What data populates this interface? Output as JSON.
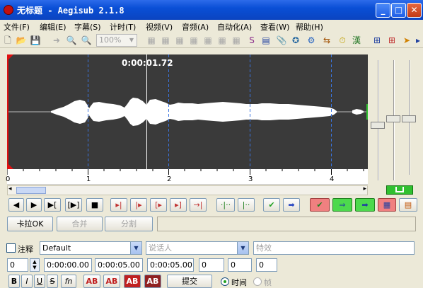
{
  "window": {
    "title": "无标题 - Aegisub 2.1.8"
  },
  "menu": [
    "文件(F)",
    "编辑(E)",
    "字幕(S)",
    "计时(T)",
    "视频(V)",
    "音频(A)",
    "自动化(A)",
    "查看(W)",
    "帮助(H)"
  ],
  "toolbar": {
    "zoom_value": "100%"
  },
  "audio": {
    "time_label": "0:00:01.72",
    "timeline_ticks": [
      "0",
      "1",
      "2",
      "3",
      "4"
    ]
  },
  "karaoke": {
    "karaoke_label": "卡拉OK",
    "join_label": "合并",
    "split_label": "分割"
  },
  "editor": {
    "comment_label": "注释",
    "style_value": "Default",
    "actor_placeholder": "说话人",
    "effect_placeholder": "特效",
    "layer_value": "0",
    "start_time": "0:00:00.00",
    "end_time": "0:00:05.00",
    "duration": "0:00:05.00",
    "margin_left": "0",
    "margin_right": "0",
    "margin_vertical": "0",
    "commit_label": "提交",
    "time_radio_label": "时间",
    "frame_radio_label": "帧"
  },
  "colors": {
    "titlebar": "#0a4fd6",
    "audio_bg": "#3a3a3a",
    "waveform": "#ffffff",
    "marker": "#2e6bd6"
  }
}
